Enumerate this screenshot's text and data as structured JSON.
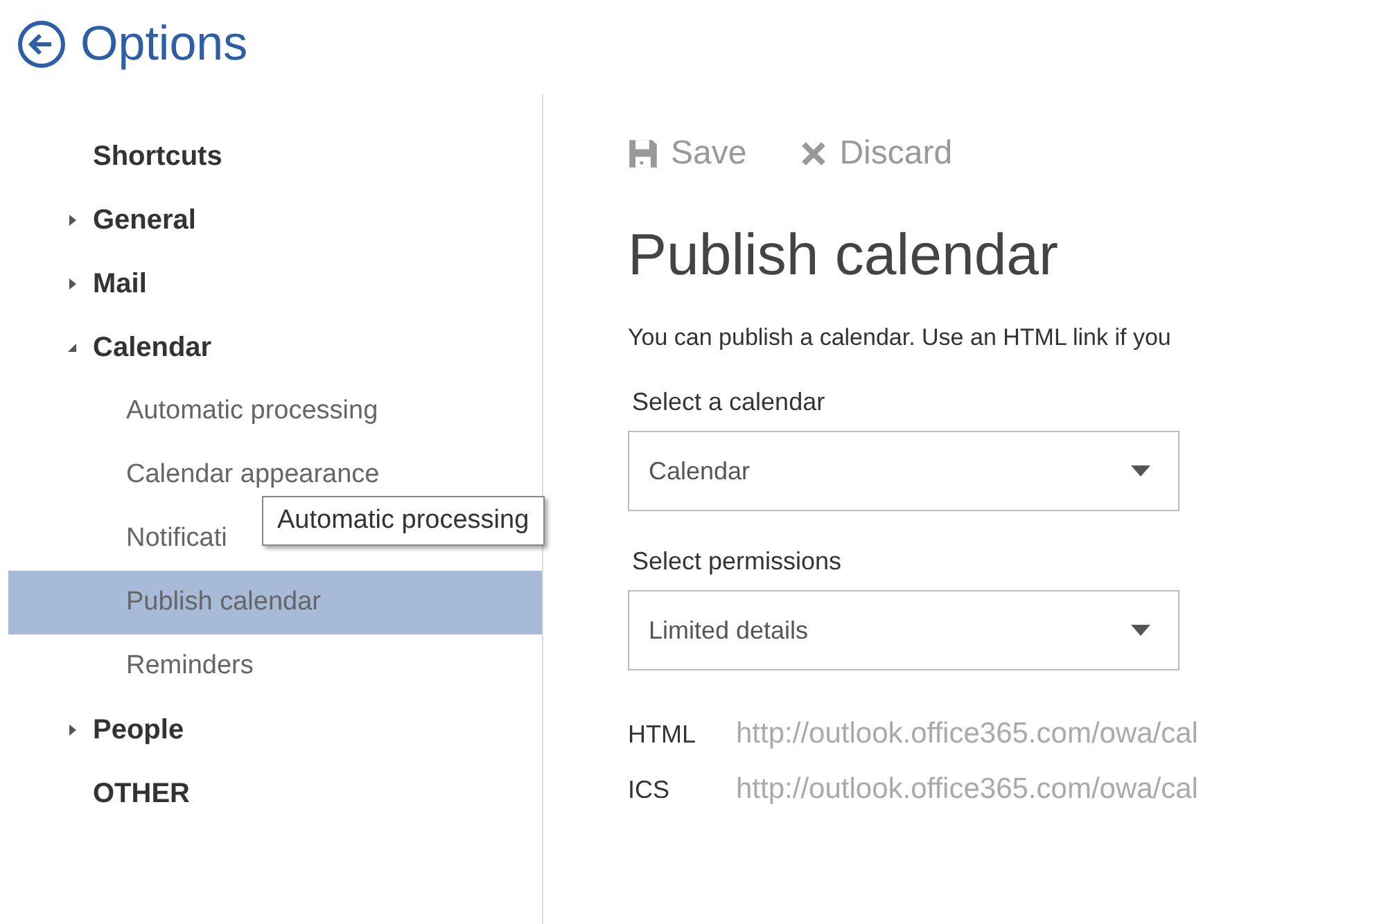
{
  "header": {
    "title": "Options"
  },
  "sidebar": {
    "items": [
      {
        "kind": "heading",
        "label": "Shortcuts"
      },
      {
        "kind": "section",
        "label": "General",
        "expanded": false
      },
      {
        "kind": "section",
        "label": "Mail",
        "expanded": false
      },
      {
        "kind": "section",
        "label": "Calendar",
        "expanded": true,
        "children": [
          {
            "label": "Automatic processing",
            "selected": false
          },
          {
            "label": "Calendar appearance",
            "selected": false
          },
          {
            "label": "Notificati",
            "selected": false
          },
          {
            "label": "Publish calendar",
            "selected": true
          },
          {
            "label": "Reminders",
            "selected": false
          }
        ]
      },
      {
        "kind": "section",
        "label": "People",
        "expanded": false
      },
      {
        "kind": "heading",
        "label": "OTHER"
      }
    ]
  },
  "tooltip": {
    "text": "Automatic processing"
  },
  "toolbar": {
    "buttons": [
      {
        "kind": "save",
        "label": "Save"
      },
      {
        "kind": "discard",
        "label": "Discard"
      }
    ]
  },
  "page": {
    "title": "Publish calendar",
    "description": "You can publish a calendar. Use an HTML link if you",
    "fields": [
      {
        "label": "Select a calendar",
        "value": "Calendar"
      },
      {
        "label": "Select permissions",
        "value": "Limited details"
      }
    ],
    "links": [
      {
        "label": "HTML",
        "url": "http://outlook.office365.com/owa/cal"
      },
      {
        "label": "ICS",
        "url": "http://outlook.office365.com/owa/cal"
      }
    ]
  }
}
